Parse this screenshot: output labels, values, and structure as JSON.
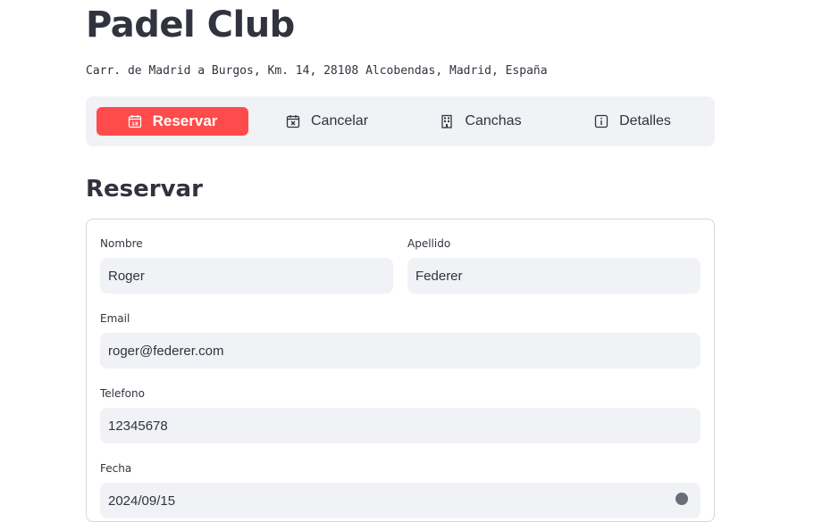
{
  "header": {
    "title": "Padel Club",
    "address": "Carr. de Madrid a Burgos, Km. 14, 28108 Alcobendas, Madrid, España"
  },
  "nav": {
    "items": [
      {
        "label": "Reservar",
        "icon": "calendar-icon",
        "active": true
      },
      {
        "label": "Cancelar",
        "icon": "calendar-x-icon",
        "active": false
      },
      {
        "label": "Canchas",
        "icon": "building-icon",
        "active": false
      },
      {
        "label": "Detalles",
        "icon": "info-icon",
        "active": false
      }
    ]
  },
  "section": {
    "title": "Reservar"
  },
  "form": {
    "nombre": {
      "label": "Nombre",
      "value": "Roger"
    },
    "apellido": {
      "label": "Apellido",
      "value": "Federer"
    },
    "email": {
      "label": "Email",
      "value": "roger@federer.com"
    },
    "telefono": {
      "label": "Telefono",
      "value": "12345678"
    },
    "fecha": {
      "label": "Fecha",
      "value": "2024/09/15"
    }
  },
  "colors": {
    "accent": "#ff4b4b",
    "surface": "#f0f2f6",
    "text": "#31333f"
  }
}
